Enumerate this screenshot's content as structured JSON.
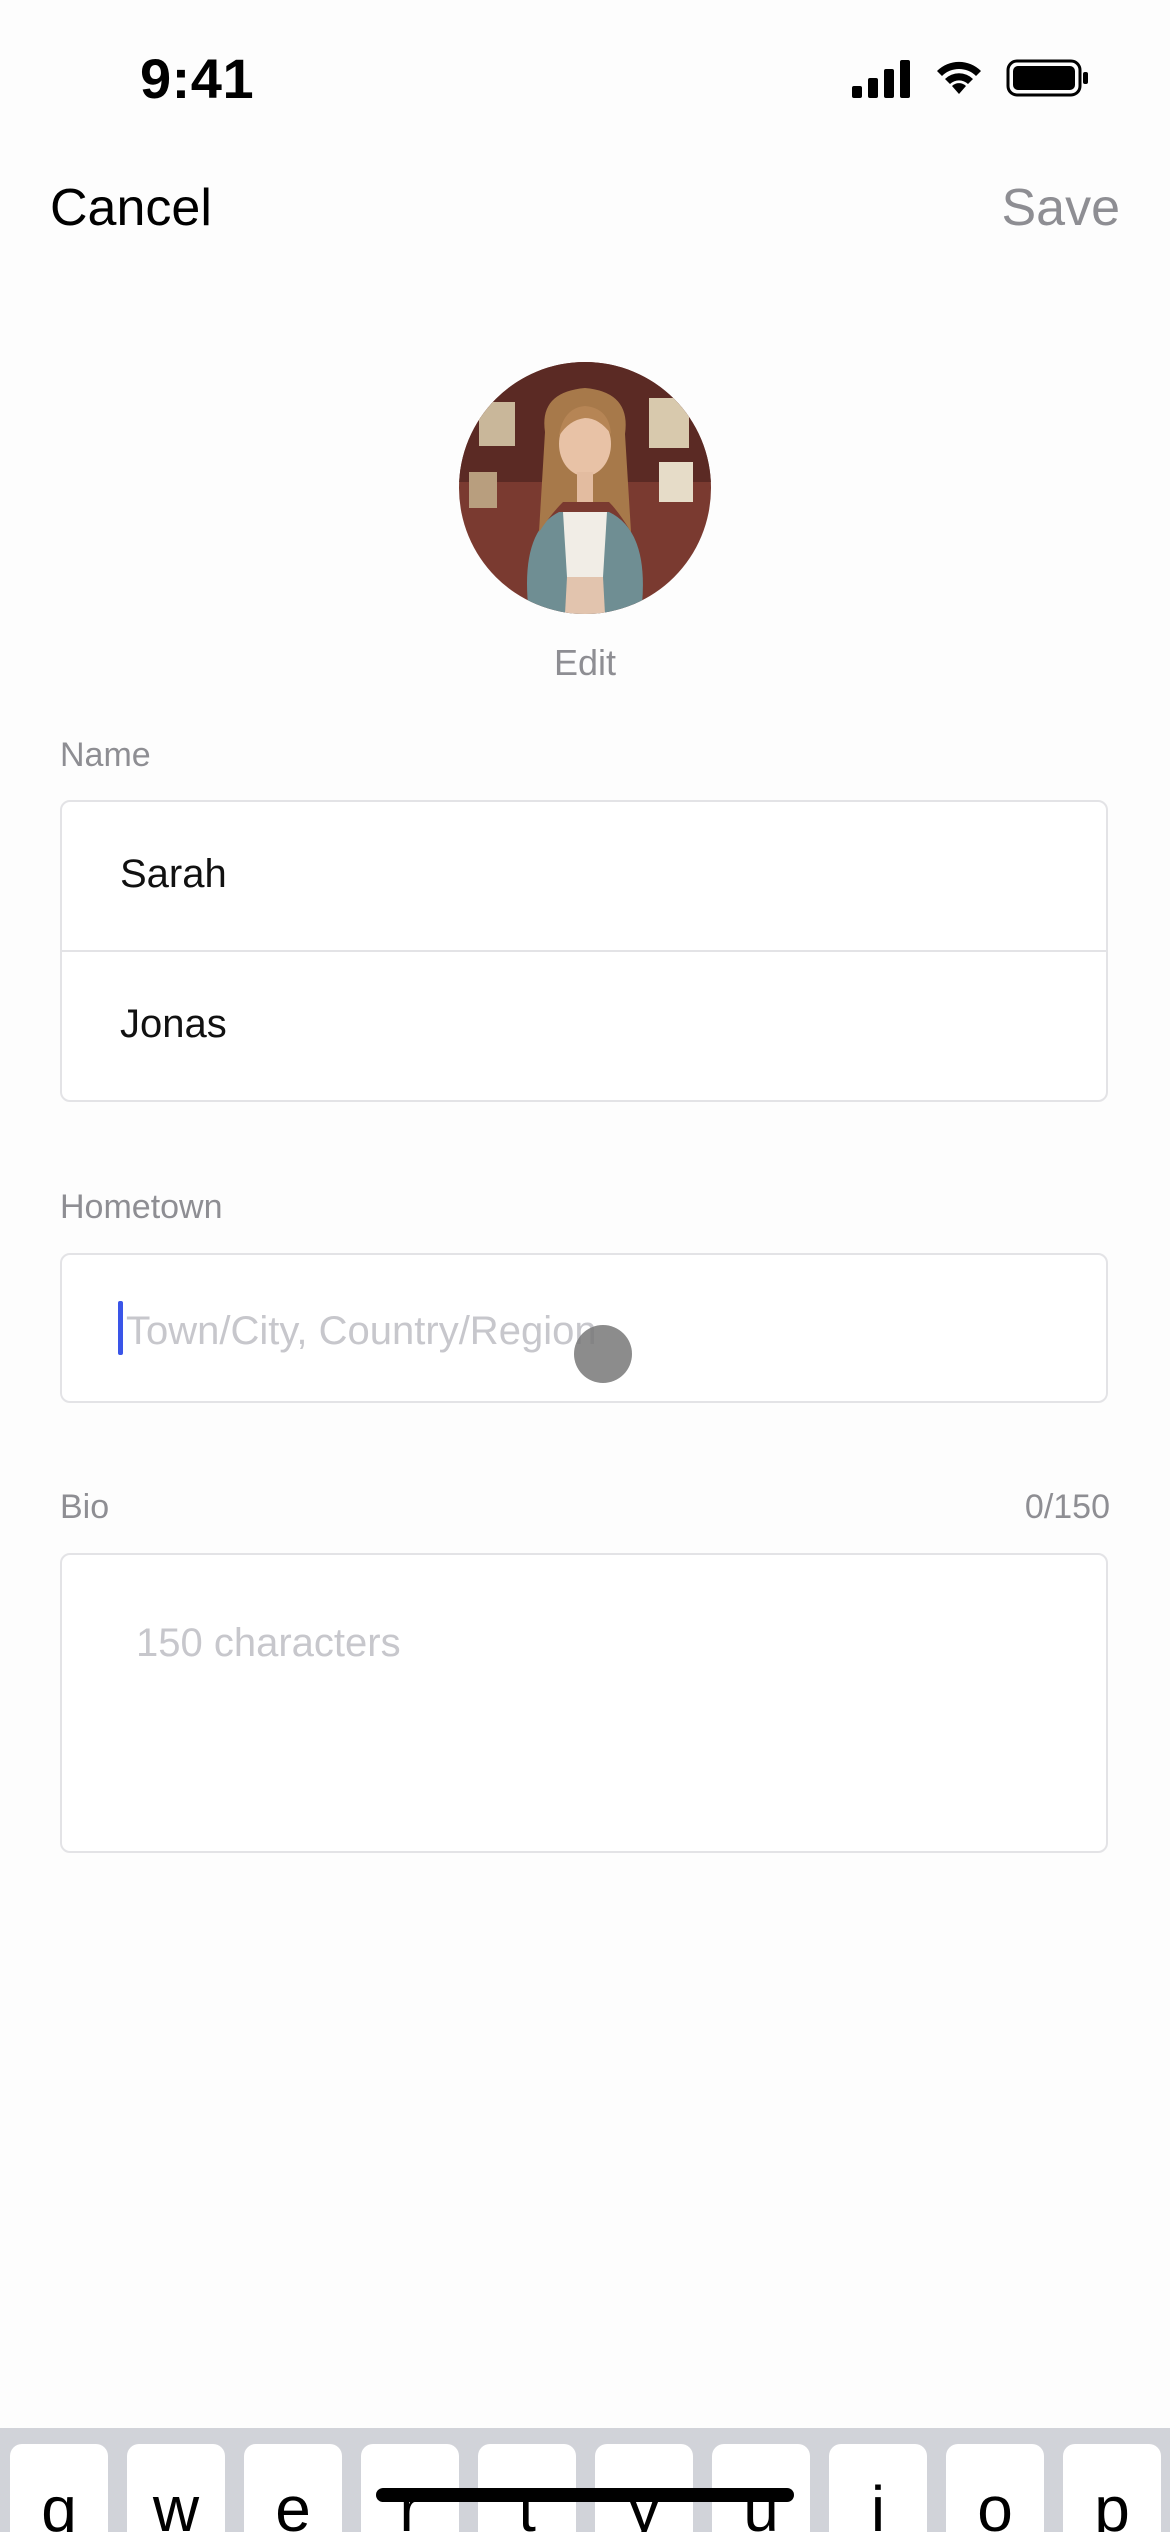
{
  "status_bar": {
    "time": "9:41",
    "icons": [
      "signal-icon",
      "wifi-icon",
      "battery-icon"
    ]
  },
  "nav": {
    "cancel_label": "Cancel",
    "save_label": "Save"
  },
  "avatar": {
    "edit_label": "Edit"
  },
  "name_section": {
    "label": "Name",
    "first_name": "Sarah",
    "last_name": "Jonas"
  },
  "hometown_section": {
    "label": "Hometown",
    "value": "",
    "placeholder": "Town/City, Country/Region"
  },
  "bio_section": {
    "label": "Bio",
    "counter": "0/150",
    "value": "",
    "placeholder": "150 characters"
  },
  "keyboard": {
    "keys": [
      "q",
      "w",
      "e",
      "r",
      "t",
      "y",
      "u",
      "i",
      "o",
      "p"
    ]
  },
  "colors": {
    "background": "#FDFDFD",
    "accent_caret": "#3A55E8",
    "secondary_text": "#8E8E93",
    "placeholder_text": "#C7C7CC",
    "field_border": "#E3E3E6",
    "keyboard_bg": "#D1D3D9"
  }
}
